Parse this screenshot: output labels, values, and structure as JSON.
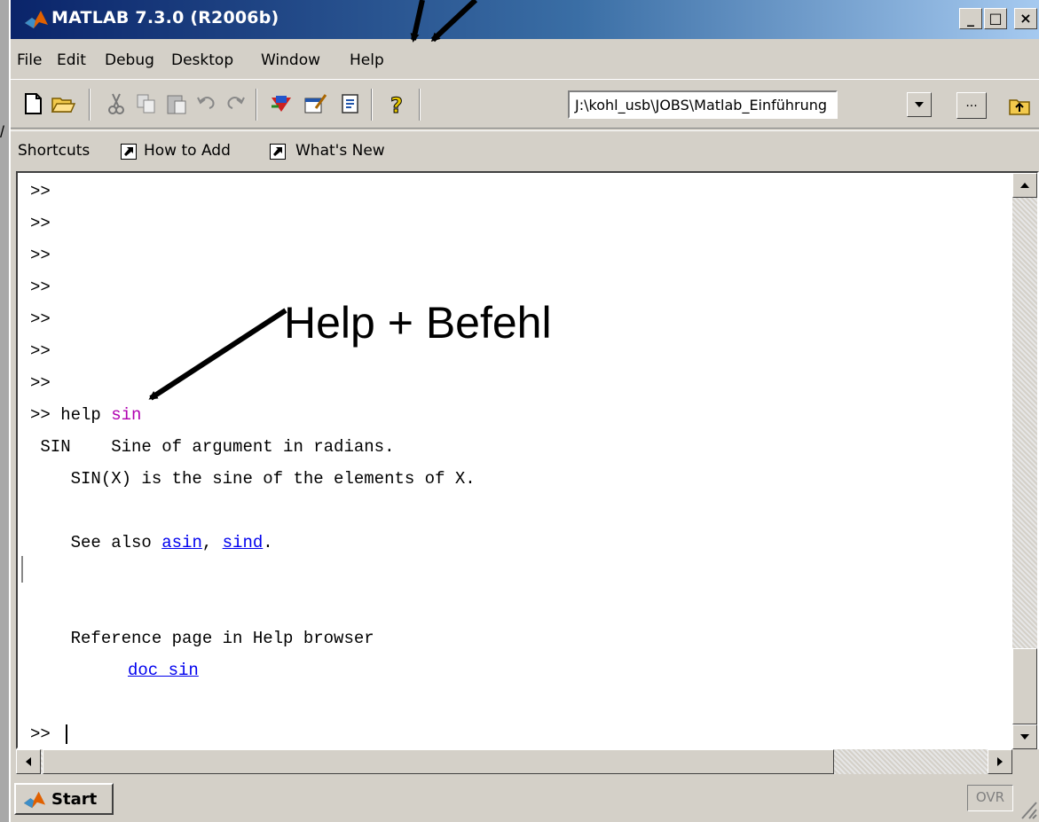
{
  "window": {
    "title": "MATLAB  7.3.0 (R2006b)",
    "controls": {
      "minimize": "_",
      "maximize": "□",
      "close": "×"
    }
  },
  "menu": [
    "File",
    "Edit",
    "Debug",
    "Desktop",
    "Window",
    "Help"
  ],
  "toolbar": {
    "current_directory": "J:\\kohl_usb\\JOBS\\Matlab_Einführung",
    "browse_label": "...",
    "icons": [
      "new-file-icon",
      "open-folder-icon",
      "cut-icon",
      "copy-icon",
      "paste-icon",
      "undo-icon",
      "redo-icon",
      "simulink-icon",
      "guide-icon",
      "profiler-icon",
      "help-icon",
      "up-folder-icon"
    ]
  },
  "shortcuts": {
    "label": "Shortcuts",
    "items": [
      "How to Add",
      "What's New"
    ]
  },
  "command_window": {
    "prompts": [
      ">>",
      ">>",
      ">>",
      ">>",
      ">>",
      ">>",
      ">>"
    ],
    "help_prompt": ">>",
    "help_cmd": "help",
    "help_arg": "sin",
    "output": {
      "line1": " SIN    Sine of argument in radians.",
      "line2": "    SIN(X) is the sine of the elements of X.",
      "see_also_prefix": "    See also ",
      "see_also_link1": "asin",
      "see_also_sep": ", ",
      "see_also_link2": "sind",
      "see_also_end": ".",
      "reference": "    Reference page in Help browser",
      "doc_link": "doc sin"
    },
    "final_prompt": ">>"
  },
  "statusbar": {
    "start_label": "Start",
    "ovr": "OVR"
  },
  "annotation": {
    "text": "Help + Befehl"
  }
}
